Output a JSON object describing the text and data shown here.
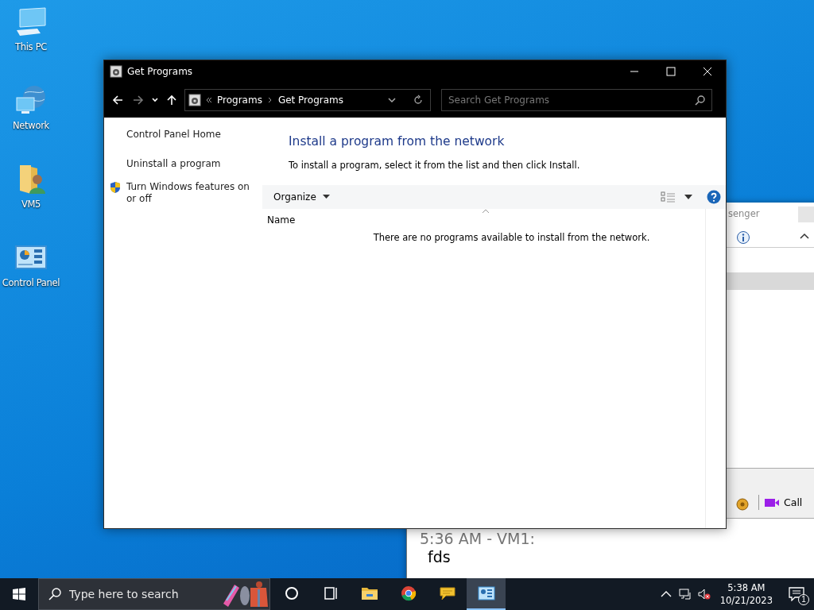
{
  "desktop_icons": [
    {
      "label": "This PC",
      "kind": "pc"
    },
    {
      "label": "Network",
      "kind": "network"
    },
    {
      "label": "VM5",
      "kind": "user-folder"
    },
    {
      "label": "Control Panel",
      "kind": "control-panel"
    }
  ],
  "messenger_window": {
    "title": "senger",
    "toolbar_button": "Call",
    "messages": [
      {
        "header": "5:36 AM - VM1:",
        "body": "fds"
      }
    ]
  },
  "window": {
    "title": "Get Programs",
    "breadcrumb": [
      "Programs",
      "Get Programs"
    ],
    "search": {
      "placeholder": "Search Get Programs"
    },
    "sidebar": {
      "items": [
        {
          "label": "Control Panel Home",
          "kind": "link"
        },
        {
          "label": "Uninstall a program",
          "kind": "link"
        },
        {
          "label": "Turn Windows features on or off",
          "kind": "shield-link"
        }
      ]
    },
    "heading": "Install a program from the network",
    "instruction": "To install a program, select it from the list and then click Install.",
    "toolbar": {
      "organize": "Organize"
    },
    "table": {
      "columns": [
        "Name"
      ],
      "empty_message": "There are no programs available to install from the network."
    }
  },
  "taskbar": {
    "search": {
      "placeholder": "Type here to search"
    },
    "apps": [
      {
        "kind": "cortana",
        "selected": false
      },
      {
        "kind": "task-view",
        "selected": false
      },
      {
        "kind": "explorer",
        "selected": false
      },
      {
        "kind": "chrome",
        "selected": false
      },
      {
        "kind": "messenger",
        "selected": false
      },
      {
        "kind": "control-panel",
        "selected": true
      }
    ],
    "time": "5:38 AM",
    "date": "10/21/2023",
    "notification_count": "1"
  }
}
